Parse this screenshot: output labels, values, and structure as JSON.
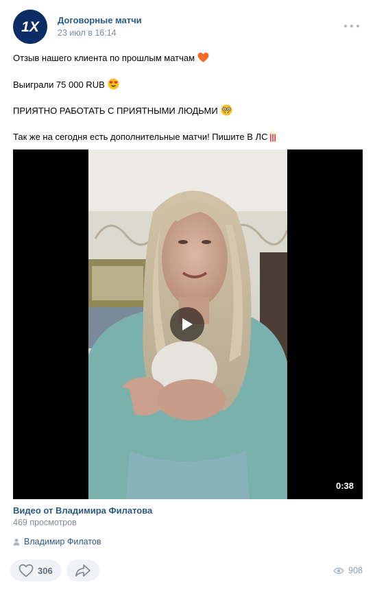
{
  "post": {
    "author": "Договорные матчи",
    "date": "23 июл в 16:14",
    "avatar_text": "1X",
    "lines": [
      "Отзыв нашего клиента по прошлым матчам",
      "Выиграли 75 000 RUB",
      "ПРИЯТНО РАБОТАТЬ С ПРИЯТНЫМИ ЛЮДЬМИ",
      "Так же на сегодня есть дополнительные матчи! Пишите В ЛС"
    ],
    "emojis": [
      "orange-heart",
      "heart-eyes-face",
      "nerd-face",
      "popcorn"
    ]
  },
  "video": {
    "duration": "0:38",
    "title": "Видео от Владимира Филатова",
    "views": "469 просмотров"
  },
  "signer": {
    "name": "Владимир Филатов"
  },
  "footer": {
    "likes": "306",
    "views": "908"
  },
  "colors": {
    "link": "#2a5885",
    "muted": "#818c99",
    "pill_bg": "#f0f2f5",
    "avatar_bg": "#0b2c64"
  }
}
